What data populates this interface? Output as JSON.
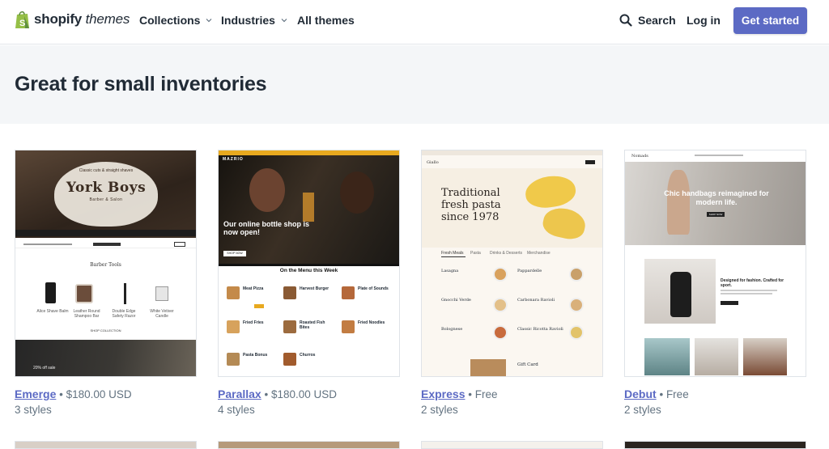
{
  "header": {
    "logo_brand": "shopify",
    "logo_suffix": "themes",
    "nav": [
      {
        "label": "Collections"
      },
      {
        "label": "Industries"
      },
      {
        "label": "All themes"
      }
    ],
    "search_label": "Search",
    "login_label": "Log in",
    "cta_label": "Get started",
    "accent_color": "#5c6ac4"
  },
  "hero": {
    "title": "Great for small inventories"
  },
  "themes": [
    {
      "name": "Emerge",
      "price": "$180.00 USD",
      "styles": "3 styles",
      "preview": {
        "banner_title": "York Boys",
        "banner_sub": "Barber & Salon",
        "tagline": "Classic cuts & straight shaves",
        "section_title": "Barber Tools",
        "products": [
          "Alice Shave Balm",
          "Leather Round Shampoo Bar",
          "Double Edge Safety Razor",
          "White Vetiver Candle"
        ],
        "button": "SHOP COLLECTION",
        "footer_text": "20% off sale"
      }
    },
    {
      "name": "Parallax",
      "price": "$180.00 USD",
      "styles": "4 styles",
      "preview": {
        "brand": "MAZRIO",
        "hero_text": "Our online bottle shop is now open!",
        "button": "SHOP NOW",
        "menu_title": "On the Menu this Week",
        "items": [
          "Meat Pizza",
          "Harvest Burger",
          "Plate of Sounds",
          "Fried Fries",
          "Roasted Fish Bites",
          "Fried Noodles",
          "Pasta Bonus",
          "Churros"
        ]
      }
    },
    {
      "name": "Express",
      "price": "Free",
      "styles": "2 styles",
      "preview": {
        "brand": "Giallo",
        "hero_text": "Traditional fresh pasta since 1978",
        "tabs": [
          "Fresh Meals",
          "Pasta",
          "Drinks & Desserts",
          "Merchandise"
        ],
        "items": [
          "Lasagna",
          "Pappardelle",
          "Gnocchi Verde",
          "Carbonara Ravioli",
          "Bolognese",
          "Classic Ricotta Ravioli"
        ],
        "gift": "Gift Card"
      }
    },
    {
      "name": "Debut",
      "price": "Free",
      "styles": "2 styles",
      "preview": {
        "brand": "Nomads",
        "hero_text": "Chic handbags reimagined for modern life.",
        "button": "SHOP NOW",
        "feature_title": "Designed for fashion. Crafted for sport."
      }
    }
  ],
  "price_separator": "•"
}
